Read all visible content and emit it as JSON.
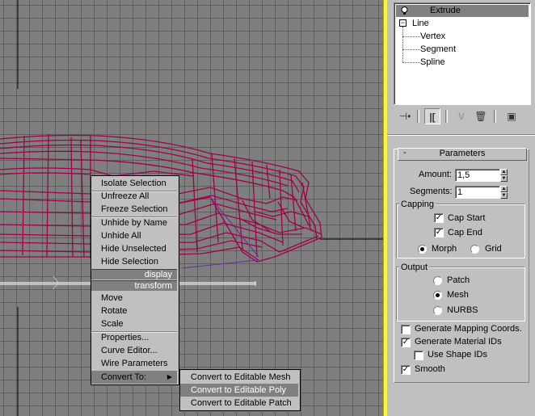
{
  "colors": {
    "wireframe": "#a0004a",
    "viewport": "#7f7f7f",
    "grid": "#5e5e5e",
    "panel": "#c0c0c0",
    "border": "#fff24a"
  },
  "modifier_stack": {
    "items": [
      {
        "label": "Extrude",
        "icon": "light-bulb-icon",
        "selected": true
      },
      {
        "label": "Line",
        "icon": "tree-collapse-icon"
      },
      {
        "label": "Vertex"
      },
      {
        "label": "Segment"
      },
      {
        "label": "Spline"
      }
    ]
  },
  "toolbar": {
    "pin": "pin-stack-icon",
    "show_end_result": "show-end-result-icon",
    "make_unique": "make-unique-icon",
    "remove_modifier": "remove-modifier-icon",
    "configure": "configure-modifier-sets-icon"
  },
  "parameters": {
    "title": "Parameters",
    "collapse": "-",
    "amount_label": "Amount:",
    "amount_value": "1,5",
    "segments_label": "Segments:",
    "segments_value": "1",
    "capping": {
      "title": "Capping",
      "cap_start": "Cap Start",
      "cap_start_checked": true,
      "cap_end": "Cap End",
      "cap_end_checked": true,
      "morph": "Morph",
      "grid": "Grid",
      "selected": "Morph"
    },
    "output": {
      "title": "Output",
      "options": [
        "Patch",
        "Mesh",
        "NURBS"
      ],
      "selected": "Mesh"
    },
    "generate_mapping": "Generate Mapping Coords.",
    "generate_mapping_checked": false,
    "generate_material_ids": "Generate Material IDs",
    "generate_material_ids_checked": true,
    "use_shape_ids": "Use Shape IDs",
    "use_shape_ids_checked": false,
    "smooth": "Smooth",
    "smooth_checked": true
  },
  "quad_menu": {
    "display_items": [
      "Isolate Selection",
      "Unfreeze All",
      "Freeze Selection",
      "Unhide by Name",
      "Unhide All",
      "Hide Unselected",
      "Hide Selection"
    ],
    "display_header": "display",
    "transform_header": "transform",
    "transform_items": [
      "Move",
      "Rotate",
      "Scale",
      "Properties...",
      "Curve Editor...",
      "Wire Parameters",
      "Convert To:"
    ],
    "submenu_arrow": "▶",
    "submenu": [
      "Convert to Editable Mesh",
      "Convert to Editable Poly",
      "Convert to Editable Patch"
    ],
    "highlighted": "Convert to Editable Poly"
  }
}
